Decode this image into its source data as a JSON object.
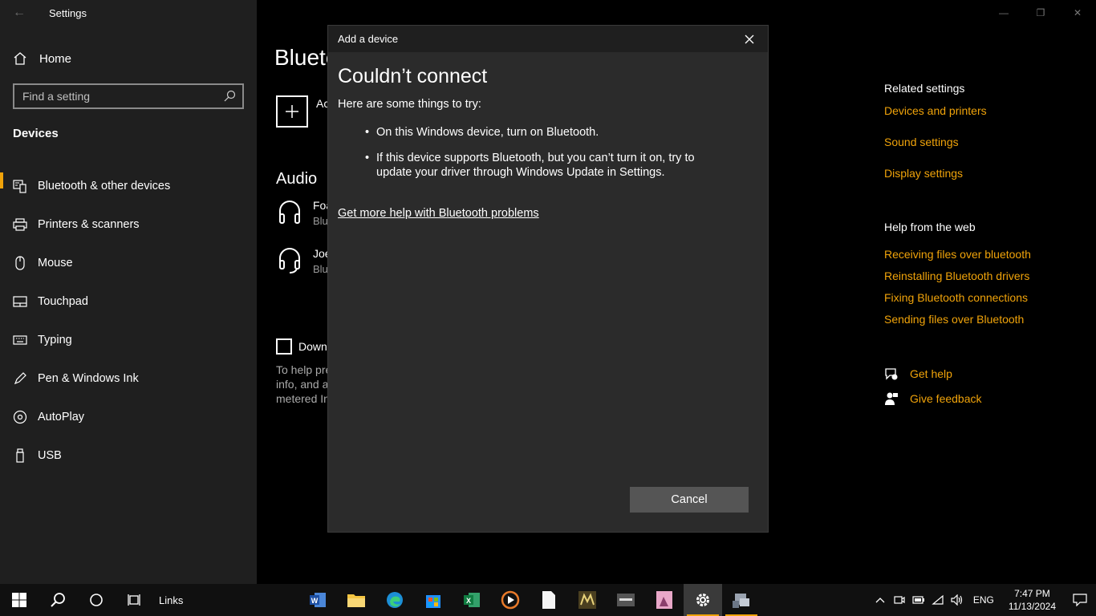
{
  "window": {
    "title": "Settings",
    "back_label": "←",
    "controls": [
      "—",
      "❐",
      "✕"
    ]
  },
  "sidebar": {
    "home_label": "Home",
    "search_placeholder": "Find a setting",
    "section_title": "Devices",
    "items": [
      {
        "label": "Bluetooth & other devices",
        "icon": "bluetooth-device-icon",
        "active": true
      },
      {
        "label": "Printers & scanners",
        "icon": "printer-icon"
      },
      {
        "label": "Mouse",
        "icon": "mouse-icon"
      },
      {
        "label": "Touchpad",
        "icon": "touchpad-icon"
      },
      {
        "label": "Typing",
        "icon": "keyboard-icon"
      },
      {
        "label": "Pen & Windows Ink",
        "icon": "pen-icon"
      },
      {
        "label": "AutoPlay",
        "icon": "autoplay-icon"
      },
      {
        "label": "USB",
        "icon": "usb-icon"
      }
    ]
  },
  "main": {
    "page_title": "Blueto",
    "add_text": "Ac",
    "audio_heading": "Audio",
    "devices": [
      {
        "name": "Foa",
        "status": "Blu",
        "icon": "headphones-icon"
      },
      {
        "name": "Joe",
        "status": "Blu",
        "icon": "headset-icon"
      }
    ],
    "checkbox_label": "Down",
    "help_lines": [
      "To help pre",
      "info, and a",
      "metered In"
    ]
  },
  "related": {
    "heading": "Related settings",
    "links": [
      "Devices and printers",
      "Sound settings",
      "Display settings"
    ],
    "web_heading": "Help from the web",
    "web_links": [
      "Receiving files over bluetooth",
      "Reinstalling Bluetooth drivers",
      "Fixing Bluetooth connections",
      "Sending files over Bluetooth"
    ],
    "get_help": "Get help",
    "give_feedback": "Give feedback"
  },
  "dialog": {
    "title": "Add a device",
    "heading": "Couldn’t connect",
    "intro": "Here are some things to try:",
    "bullets": [
      "On this Windows device, turn on Bluetooth.",
      "If this device supports Bluetooth, but you can’t turn it on, try to update your driver through Windows Update in Settings."
    ],
    "help_link": "Get more help with Bluetooth problems",
    "cancel_label": "Cancel"
  },
  "taskbar": {
    "links_label": "Links",
    "language": "ENG",
    "time": "7:47 PM",
    "date": "11/13/2024",
    "accent_color": "#f0a30a"
  }
}
